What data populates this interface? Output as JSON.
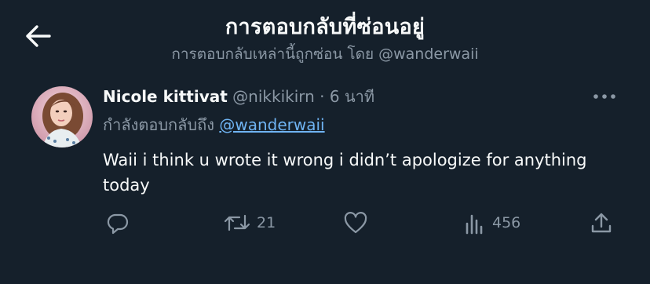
{
  "header": {
    "title": "การตอบกลับที่ซ่อนอยู่",
    "subtitle": "การตอบกลับเหล่านี้ถูกซ่อน โดย @wanderwaii",
    "back_icon": "arrow-left-icon"
  },
  "tweet": {
    "author_name": "Nicole kittivat",
    "author_handle": "@nikkikirn",
    "separator": "·",
    "time": "6 นาที",
    "reply_prefix": "กำลังตอบกลับถึง",
    "reply_to": "@wanderwaii",
    "text": "Waii i think u wrote it wrong i didn’t apologize for anything today",
    "more_icon": "more-horizontal-icon",
    "actions": {
      "reply": {
        "icon": "reply-icon",
        "count": ""
      },
      "retweet": {
        "icon": "retweet-icon",
        "count": "21"
      },
      "like": {
        "icon": "heart-icon",
        "count": ""
      },
      "views": {
        "icon": "views-icon",
        "count": "456"
      },
      "share": {
        "icon": "share-icon",
        "count": ""
      }
    }
  },
  "colors": {
    "background": "#15202b",
    "text_primary": "#f7f9f9",
    "text_secondary": "#8b98a5",
    "link": "#6fb3f2"
  }
}
